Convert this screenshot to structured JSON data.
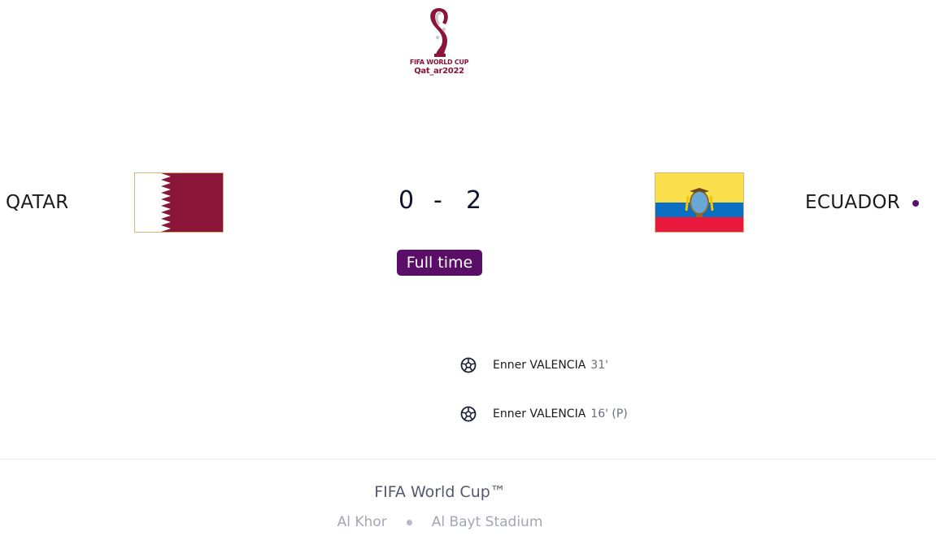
{
  "logo": {
    "line1": "FIFA WORLD CUP",
    "line2": "Qat_ar2022"
  },
  "home": {
    "name": "QATAR",
    "score": "0",
    "flag": "qatar-flag"
  },
  "away": {
    "name": "ECUADOR",
    "score": "2",
    "flag": "ecuador-flag"
  },
  "score_separator": "-",
  "status": "Full time",
  "goals": [
    {
      "player": "Enner VALENCIA",
      "minute": "31'"
    },
    {
      "player": "Enner VALENCIA",
      "minute": "16' (P)"
    }
  ],
  "footer": {
    "competition": "FIFA World Cup™",
    "city": "Al Khor",
    "stadium": "Al Bayt Stadium"
  },
  "colors": {
    "accent": "#5b0e68",
    "qatar_maroon": "#8a1538",
    "ecuador_yellow": "#fcdf4c",
    "ecuador_blue": "#0a6fc2",
    "ecuador_red": "#e8193c"
  },
  "icons": {
    "goal": "soccer-ball-icon",
    "winner": "winner-dot-icon"
  }
}
